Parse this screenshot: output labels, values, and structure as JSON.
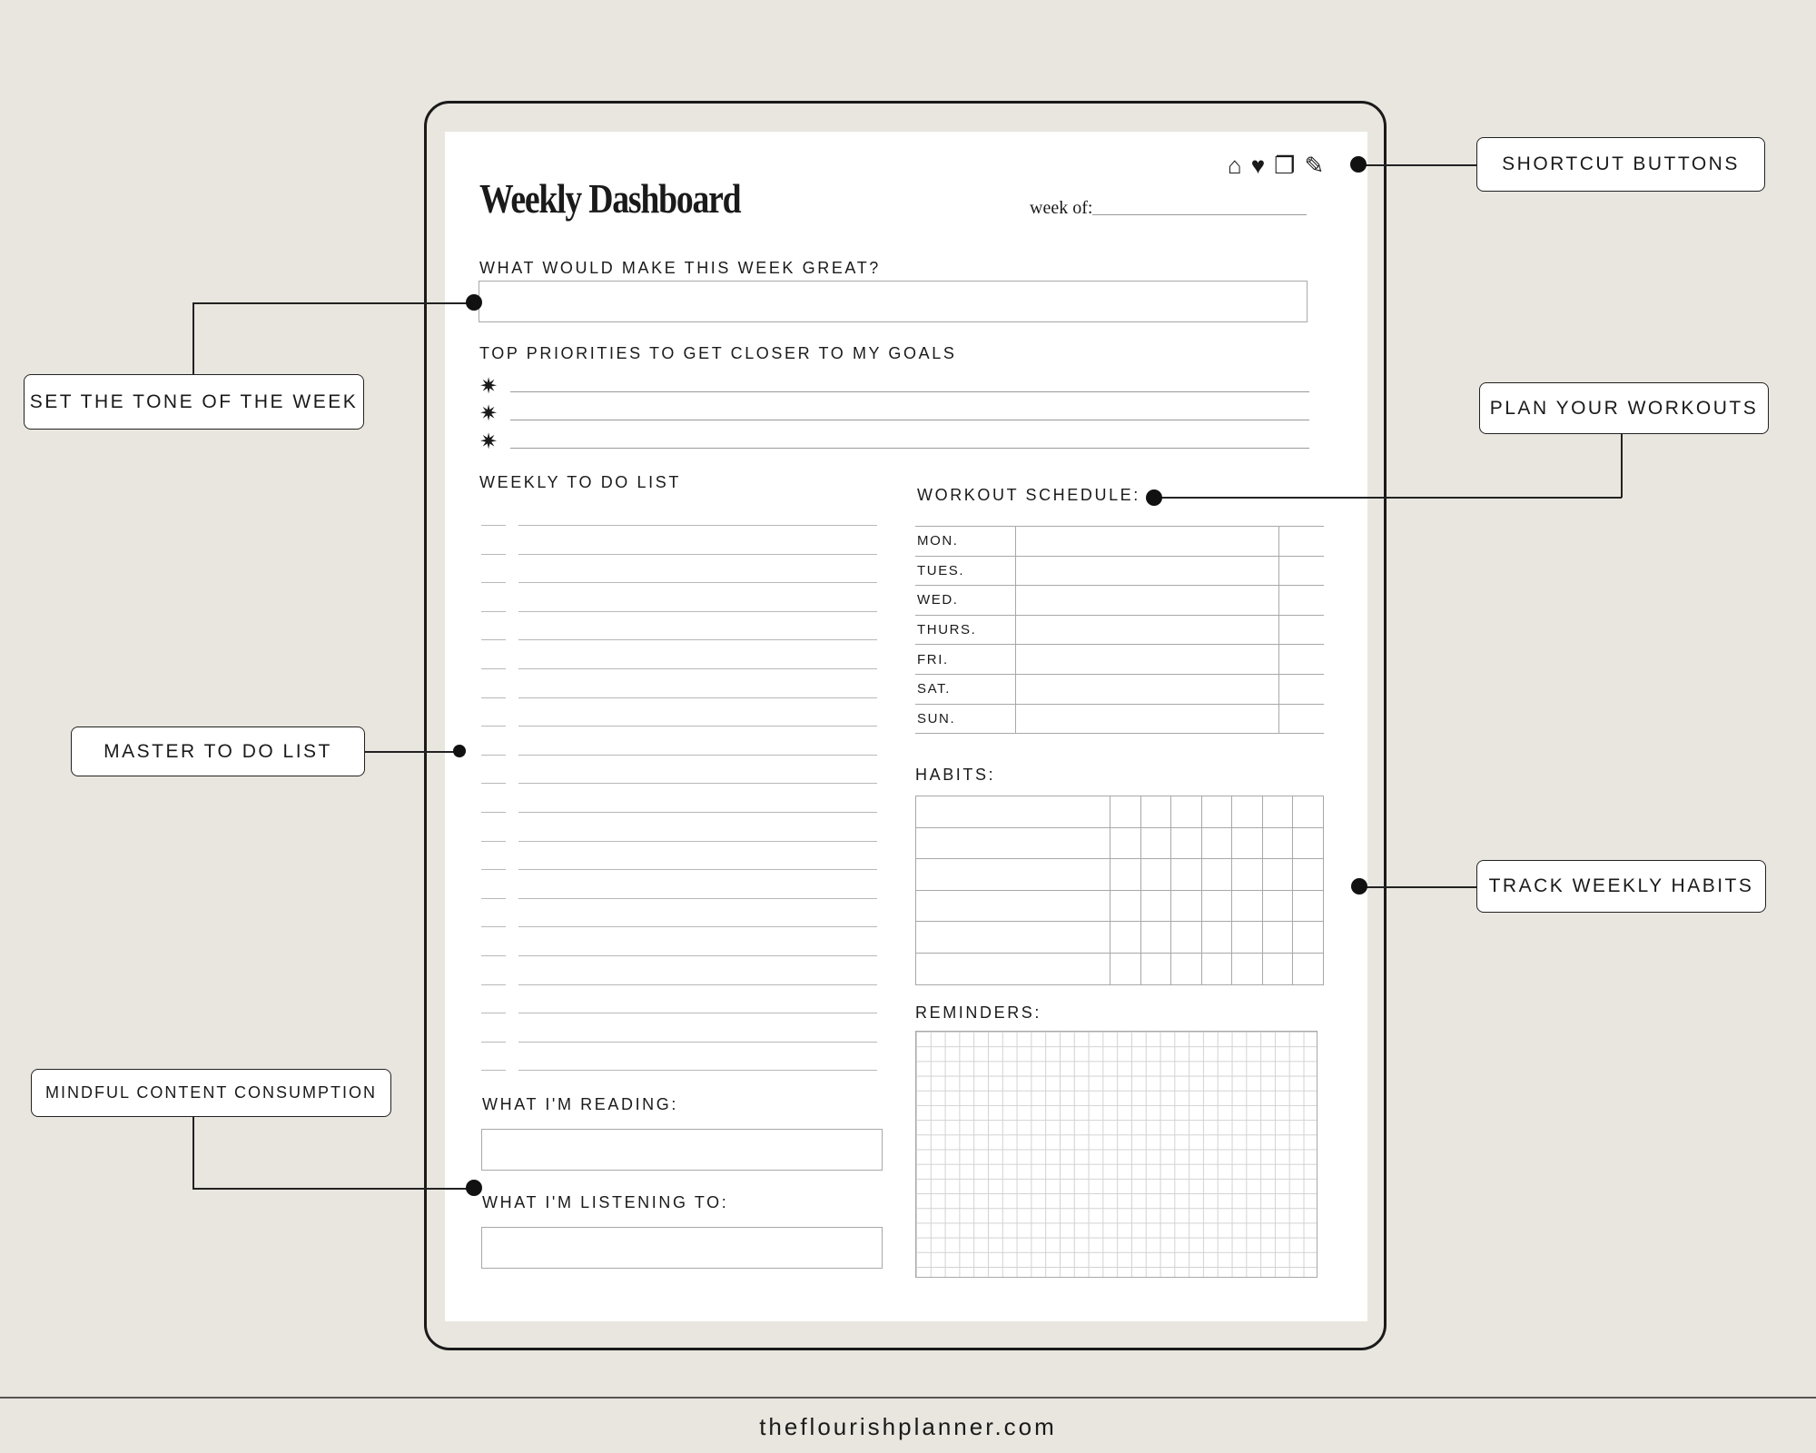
{
  "page": {
    "title": "Weekly Dashboard",
    "week_of_label": "week of:",
    "shortcut_icons": [
      "home-icon",
      "heart-icon",
      "square-icon",
      "pencil-icon"
    ],
    "shortcut_glyphs": [
      "⌂",
      "♥",
      "❐",
      "✎"
    ]
  },
  "sections": {
    "week_great": "WHAT WOULD MAKE THIS WEEK GREAT?",
    "priorities": "TOP PRIORITIES TO GET CLOSER TO MY GOALS",
    "priority_bullet": "✷",
    "todo": "WEEKLY TO DO LIST",
    "workout": "WORKOUT SCHEDULE:",
    "habits": "HABITS:",
    "reminders": "REMINDERS:",
    "reading": "WHAT I'M READING:",
    "listening": "WHAT I'M LISTENING TO:"
  },
  "workout_days": [
    "MON.",
    "TUES.",
    "WED.",
    "THURS.",
    "FRI.",
    "SAT.",
    "SUN."
  ],
  "callouts": {
    "shortcut": "SHORTCUT BUTTONS",
    "tone": "SET THE TONE OF THE WEEK",
    "workouts": "PLAN YOUR WORKOUTS",
    "master": "MASTER TO DO LIST",
    "habits": "TRACK WEEKLY HABITS",
    "mindful": "MINDFUL CONTENT CONSUMPTION"
  },
  "footer": "theflourishplanner.com"
}
